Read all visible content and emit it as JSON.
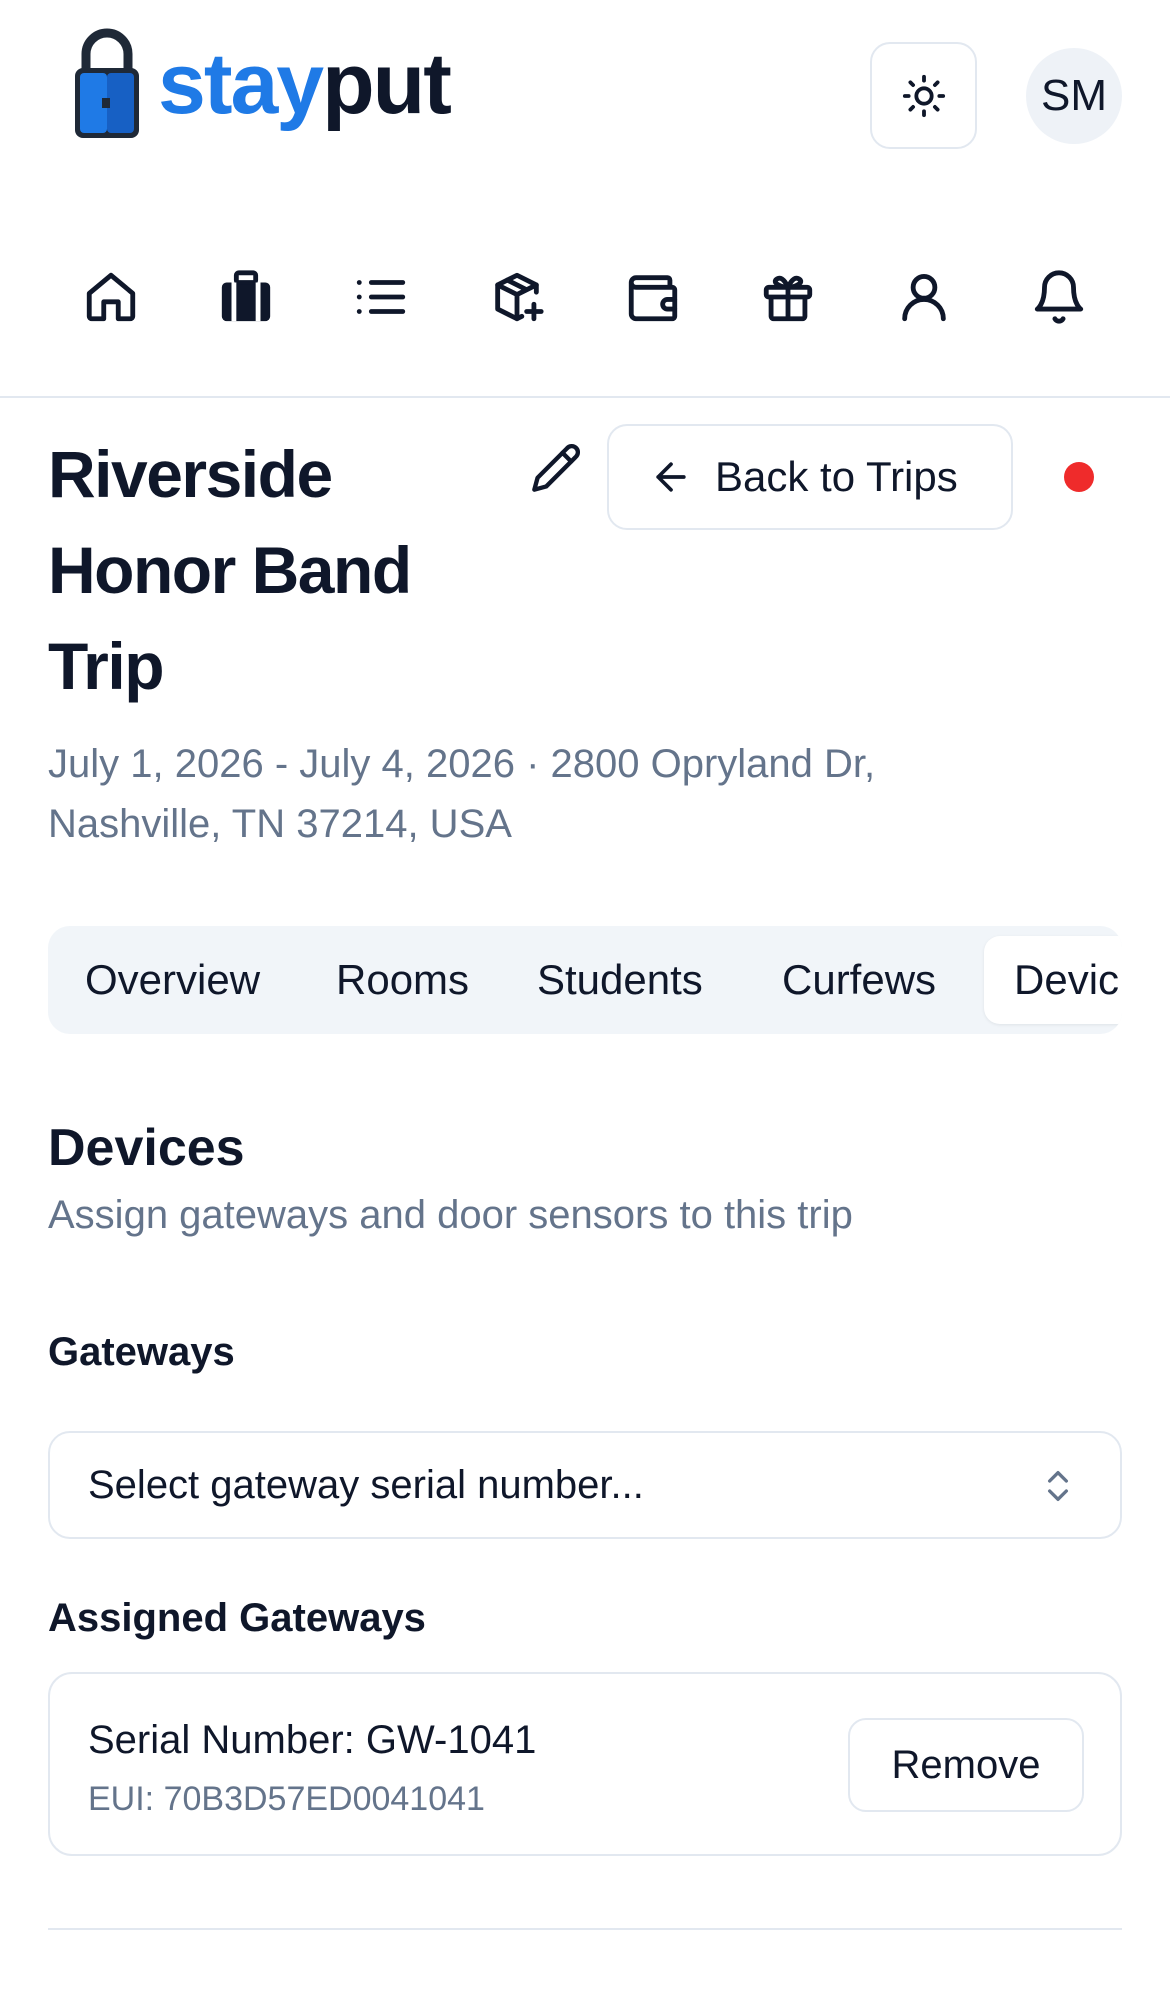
{
  "header": {
    "logo_part1": "stay",
    "logo_part2": "put",
    "theme_icon": "sun-icon",
    "avatar_initials": "SM"
  },
  "nav": {
    "items": [
      {
        "icon": "home-icon"
      },
      {
        "icon": "luggage-icon"
      },
      {
        "icon": "list-icon"
      },
      {
        "icon": "package-plus-icon"
      },
      {
        "icon": "wallet-icon"
      },
      {
        "icon": "gift-icon"
      },
      {
        "icon": "user-icon"
      },
      {
        "icon": "bell-icon"
      }
    ]
  },
  "trip": {
    "title": "Riverside Honor Band Trip",
    "meta": "July 1, 2026 - July 4, 2026 · 2800 Opryland Dr, Nashville, TN 37214, USA",
    "back_label": "Back to Trips",
    "status_color": "#ef2b2b"
  },
  "tabs": [
    {
      "label": "Overview",
      "active": false
    },
    {
      "label": "Rooms",
      "active": false
    },
    {
      "label": "Students",
      "active": false
    },
    {
      "label": "Curfews",
      "active": false
    },
    {
      "label": "Devic",
      "active": true
    }
  ],
  "devices": {
    "title": "Devices",
    "subtitle": "Assign gateways and door sensors to this trip",
    "gateways_label": "Gateways",
    "select_placeholder": "Select gateway serial number...",
    "assigned_label": "Assigned Gateways",
    "assigned": [
      {
        "serial": "Serial Number: GW-1041",
        "eui": "EUI: 70B3D57ED0041041",
        "remove_label": "Remove"
      }
    ]
  },
  "colors": {
    "brand_blue": "#1f7ae6",
    "text": "#0f172a",
    "muted": "#64748b",
    "border": "#e2e8f0",
    "tabs_bg": "#f1f5f9"
  }
}
